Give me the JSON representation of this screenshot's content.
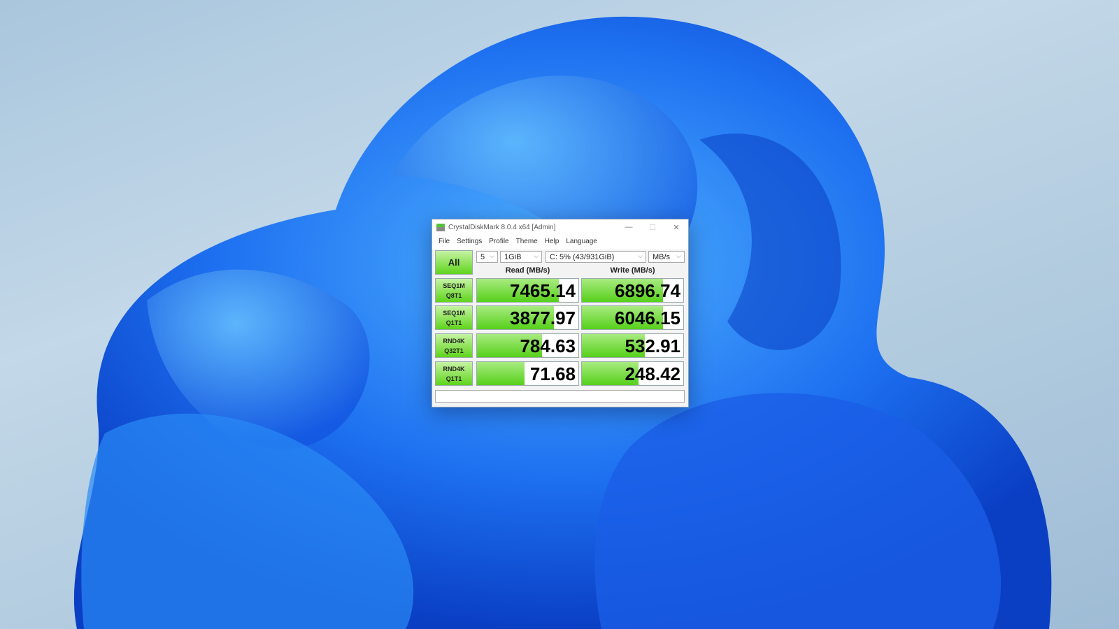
{
  "window": {
    "title": "CrystalDiskMark 8.0.4 x64 [Admin]",
    "minimize": "—",
    "maximize": "☐",
    "close": "✕"
  },
  "menu": [
    "File",
    "Settings",
    "Profile",
    "Theme",
    "Help",
    "Language"
  ],
  "controls": {
    "all_label": "All",
    "count": "5",
    "size": "1GiB",
    "drive": "C: 5% (43/931GiB)",
    "unit": "MB/s"
  },
  "headers": {
    "read": "Read (MB/s)",
    "write": "Write (MB/s)"
  },
  "rows": [
    {
      "line1": "SEQ1M",
      "line2": "Q8T1",
      "read": "7465.14",
      "write": "6896.74",
      "read_fill": 0.81,
      "write_fill": 0.8
    },
    {
      "line1": "SEQ1M",
      "line2": "Q1T1",
      "read": "3877.97",
      "write": "6046.15",
      "read_fill": 0.76,
      "write_fill": 0.8
    },
    {
      "line1": "RND4K",
      "line2": "Q32T1",
      "read": "784.63",
      "write": "532.91",
      "read_fill": 0.64,
      "write_fill": 0.62
    },
    {
      "line1": "RND4K",
      "line2": "Q1T1",
      "read": "71.68",
      "write": "248.42",
      "read_fill": 0.47,
      "write_fill": 0.56
    }
  ],
  "status": ""
}
